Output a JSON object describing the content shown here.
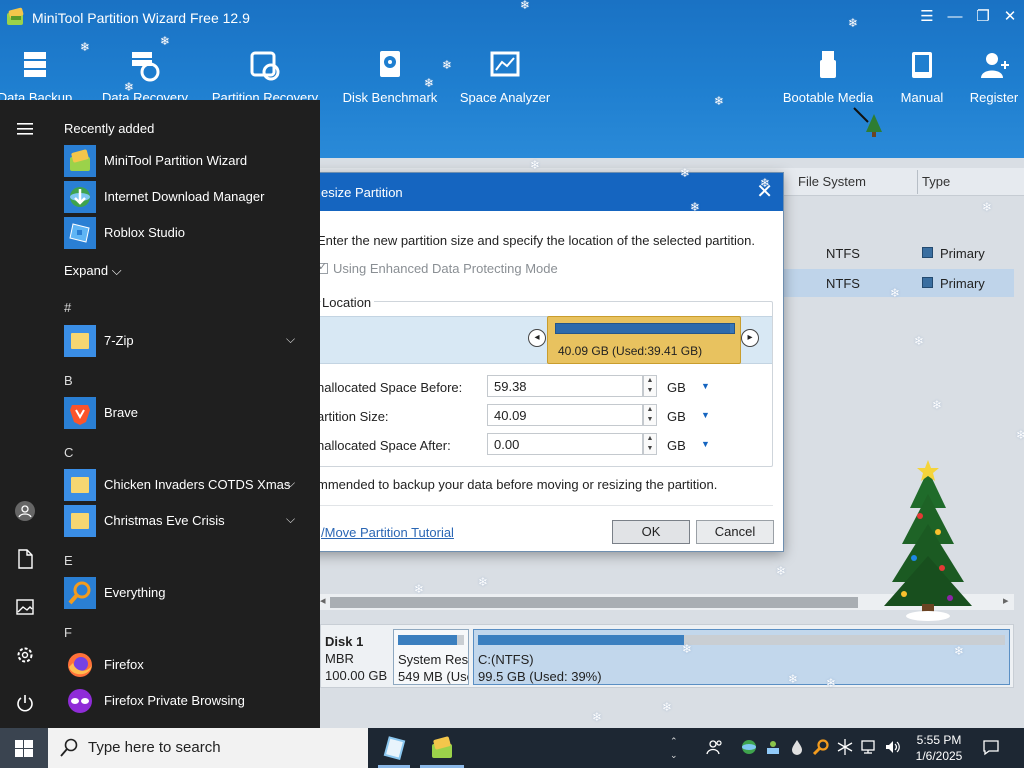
{
  "app": {
    "title": "MiniTool Partition Wizard Free 12.9",
    "toolbar": [
      {
        "label": "Data Backup",
        "icon": "data-backup-icon"
      },
      {
        "label": "Data Recovery",
        "icon": "data-recovery-icon"
      },
      {
        "label": "Partition Recovery",
        "icon": "partition-recovery-icon"
      },
      {
        "label": "Disk Benchmark",
        "icon": "disk-benchmark-icon"
      },
      {
        "label": "Space Analyzer",
        "icon": "space-analyzer-icon"
      },
      {
        "label": "Bootable Media",
        "icon": "bootable-media-icon"
      },
      {
        "label": "Manual",
        "icon": "manual-icon"
      },
      {
        "label": "Register",
        "icon": "register-icon"
      }
    ],
    "table": {
      "columns": [
        "File System",
        "Type"
      ],
      "rows": [
        {
          "file_system": "NTFS",
          "type": "Primary",
          "selected": false
        },
        {
          "file_system": "NTFS",
          "type": "Primary",
          "selected": true
        }
      ]
    },
    "disk_map": {
      "name": "Disk 1",
      "style": "MBR",
      "size": "100.00 GB",
      "partitions": [
        {
          "label": "System Rese",
          "detail": "549 MB (Use",
          "used_fraction": 0.9,
          "selected": false
        },
        {
          "label": "C:(NTFS)",
          "detail": "99.5 GB (Used: 39%)",
          "used_fraction": 0.39,
          "selected": true
        }
      ]
    }
  },
  "dialog": {
    "title": "esize Partition",
    "instruction": "Enter the new partition size and specify the location of the selected partition.",
    "checkbox_label": "Using Enhanced Data Protecting Mode",
    "group_label": "Location",
    "partition_block": "40.09 GB (Used:39.41 GB)",
    "partition_used_fraction": 0.98,
    "fields": [
      {
        "label": "nallocated Space Before:",
        "value": "59.38",
        "unit": "GB"
      },
      {
        "label": "artition Size:",
        "value": "40.09",
        "unit": "GB"
      },
      {
        "label": "nallocated Space After:",
        "value": "0.00",
        "unit": "GB"
      }
    ],
    "recommend": "mmended to backup your data before moving or resizing the partition.",
    "tutorial_link": "/Move Partition Tutorial",
    "ok": "OK",
    "cancel": "Cancel"
  },
  "start_menu": {
    "recently_added": "Recently added",
    "recent": [
      {
        "label": "MiniTool Partition Wizard",
        "icon": "minitool-icon"
      },
      {
        "label": "Internet Download Manager",
        "icon": "idm-icon"
      },
      {
        "label": "Roblox Studio",
        "icon": "roblox-studio-icon"
      }
    ],
    "expand": "Expand",
    "letters": [
      "#",
      "B",
      "C",
      "E",
      "F"
    ],
    "apps": [
      {
        "label": "7-Zip",
        "icon": "folder-icon",
        "expandable": true
      },
      {
        "label": "Brave",
        "icon": "brave-icon",
        "expandable": false
      },
      {
        "label": "Chicken Invaders COTDS Xmas",
        "icon": "folder-icon",
        "expandable": true
      },
      {
        "label": "Christmas Eve Crisis",
        "icon": "folder-icon",
        "expandable": true
      },
      {
        "label": "Everything",
        "icon": "everything-icon",
        "expandable": false
      },
      {
        "label": "Firefox",
        "icon": "firefox-icon",
        "expandable": false
      },
      {
        "label": "Firefox Private Browsing",
        "icon": "firefox-private-icon",
        "expandable": false
      }
    ]
  },
  "taskbar": {
    "search_placeholder": "Type here to search",
    "time": "5:55 PM",
    "date": "1/6/2025"
  },
  "colors": {
    "ribbon": "#1f7fd0",
    "dialog_title": "#1565c0",
    "partition_block": "#e8c25f",
    "start_bg": "#1f1f1f",
    "taskbar_bg": "#1d2733"
  }
}
